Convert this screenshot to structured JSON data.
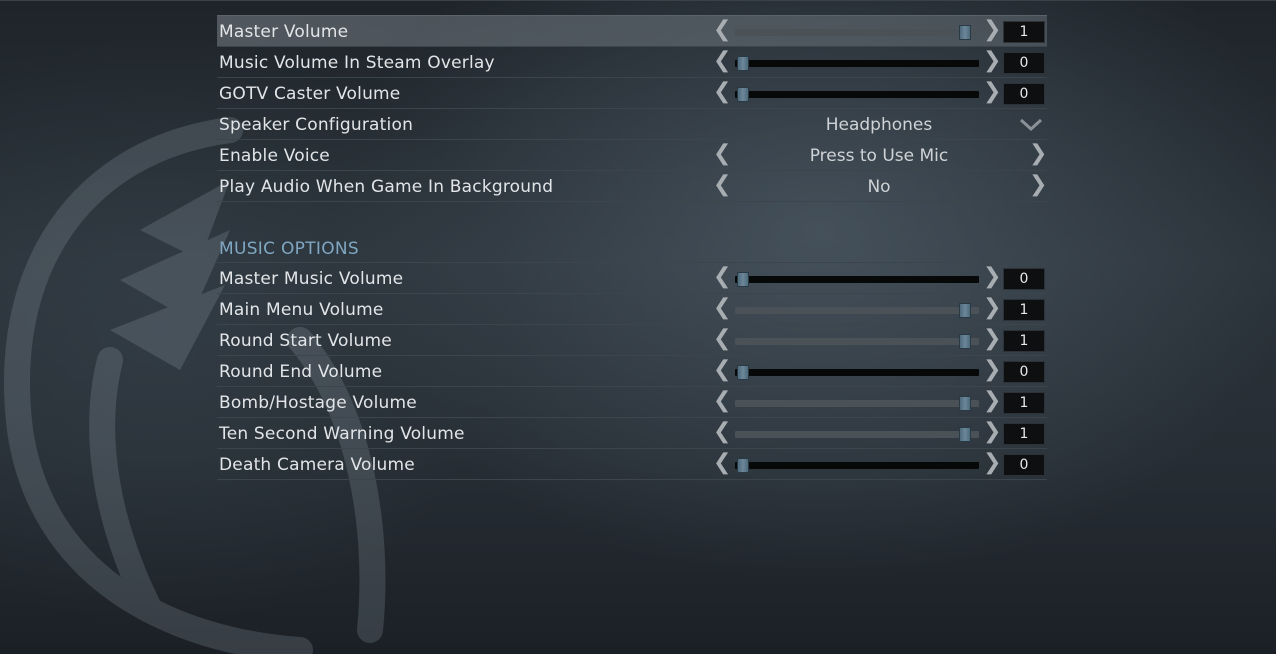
{
  "audio_settings": [
    {
      "label": "Master Volume",
      "control": "slider",
      "value": "1",
      "level": 1,
      "highlighted": true
    },
    {
      "label": "Music Volume In Steam Overlay",
      "control": "slider",
      "value": "0",
      "level": 0
    },
    {
      "label": "GOTV Caster Volume",
      "control": "slider",
      "value": "0",
      "level": 0
    },
    {
      "label": "Speaker Configuration",
      "control": "dropdown",
      "value": "Headphones"
    },
    {
      "label": "Enable Voice",
      "control": "selector",
      "value": "Press to Use Mic"
    },
    {
      "label": "Play Audio When Game In Background",
      "control": "selector",
      "value": "No"
    }
  ],
  "music_section": {
    "title": "MUSIC OPTIONS",
    "items": [
      {
        "label": "Master Music Volume",
        "value": "0",
        "level": 0
      },
      {
        "label": "Main Menu Volume",
        "value": "1",
        "level": 1
      },
      {
        "label": "Round Start Volume",
        "value": "1",
        "level": 1
      },
      {
        "label": "Round End Volume",
        "value": "0",
        "level": 0
      },
      {
        "label": "Bomb/Hostage Volume",
        "value": "1",
        "level": 1
      },
      {
        "label": "Ten Second Warning Volume",
        "value": "1",
        "level": 1
      },
      {
        "label": "Death Camera Volume",
        "value": "0",
        "level": 0
      }
    ]
  },
  "icons": {
    "left_arrow": "❮",
    "right_arrow": "❯",
    "dropdown": "chevron-down-icon",
    "background": "ct-emblem-icon"
  },
  "colors": {
    "section_title": "#7fa7c2",
    "slider_thumb": "#6b8798",
    "track_empty": "#070808",
    "track_filled": "#4a5157"
  }
}
